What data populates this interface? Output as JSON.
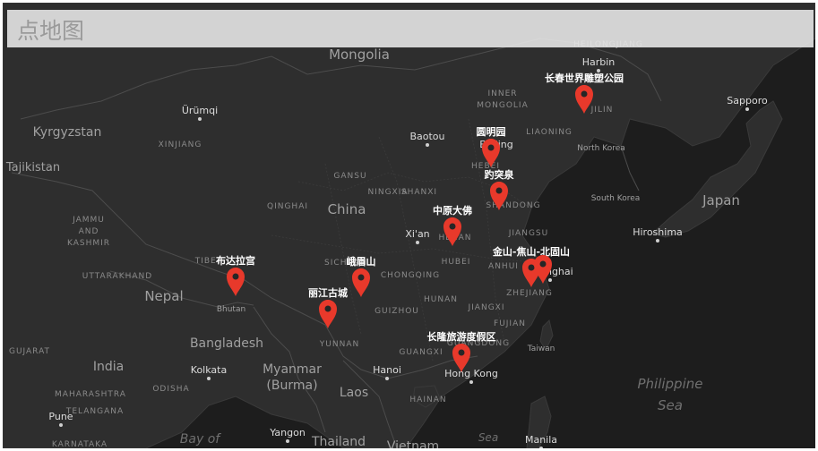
{
  "title": "点地图",
  "colors": {
    "marker": "#e8392b",
    "land": "#2d2d2d",
    "sea": "#1c1c1c",
    "border": "#4a4a4a",
    "text": "#9b9b9b"
  },
  "markers": [
    {
      "name": "长春世界雕塑公园",
      "icon": "map-pin-icon"
    },
    {
      "name": "圆明园",
      "icon": "map-pin-icon"
    },
    {
      "name": "趵突泉",
      "icon": "map-pin-icon"
    },
    {
      "name": "中原大佛",
      "icon": "map-pin-icon"
    },
    {
      "name": "金山-焦山-北固山",
      "icon": "map-pin-icon"
    },
    {
      "name": "布达拉宫",
      "icon": "map-pin-icon"
    },
    {
      "name": "峨眉山",
      "icon": "map-pin-icon"
    },
    {
      "name": "丽江古城",
      "icon": "map-pin-icon"
    },
    {
      "name": "长隆旅游度假区",
      "icon": "map-pin-icon"
    },
    {
      "name": "",
      "icon": "map-pin-icon"
    }
  ],
  "country_labels": [
    "Mongolia",
    "China",
    "Kyrgyzstan",
    "Tajikistan",
    "Nepal",
    "Bhutan",
    "Bangladesh",
    "India",
    "Myanmar",
    "(Burma)",
    "Laos",
    "Thailand",
    "Vietnam",
    "Japan",
    "North Korea",
    "South Korea",
    "Taiwan"
  ],
  "region_labels": [
    "HEILONGJIANG",
    "INNER",
    "MONGOLIA",
    "JILIN",
    "LIAONING",
    "XINJIANG",
    "GANSU",
    "NINGXIA",
    "SHANXI",
    "HEBEI",
    "SHANDONG",
    "QINGHAI",
    "JAMMU",
    "AND",
    "KASHMIR",
    "TIBET",
    "HENAN",
    "JIANGSU",
    "ANHUI",
    "SICHUAN",
    "CHONGQING",
    "HUBEI",
    "ZHEJIANG",
    "HUNAN",
    "JIANGXI",
    "UTTARAKHAND",
    "GUIZHOU",
    "FUJIAN",
    "YUNNAN",
    "GUANGDONG",
    "GUANGXI",
    "GUJARAT",
    "ODISHA",
    "MAHARASHTRA",
    "TELANGANA",
    "HAINAN",
    "KARNATAKA"
  ],
  "city_labels": [
    "Harbin",
    "Sapporo",
    "Ürümqi",
    "Baotou",
    "Beijing",
    "Xi'an",
    "Hiroshima",
    "Shanghai",
    "Kolkata",
    "Hanoi",
    "Hong Kong",
    "Pune",
    "Yangon",
    "Manila"
  ],
  "water_labels": [
    "Philippine",
    "Sea",
    "Bay of",
    "Sea"
  ]
}
